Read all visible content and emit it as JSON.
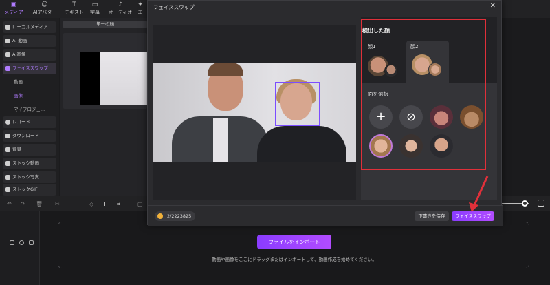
{
  "toolbar": {
    "items": [
      {
        "label": "メディア",
        "icon": "media-icon"
      },
      {
        "label": "AIアバター",
        "icon": "avatar-icon"
      },
      {
        "label": "テキスト",
        "icon": "text-icon"
      },
      {
        "label": "字幕",
        "icon": "subtitle-icon"
      },
      {
        "label": "オーディオ",
        "icon": "audio-icon"
      },
      {
        "label": "エ",
        "icon": "effects-icon"
      }
    ]
  },
  "sidebar": {
    "items": [
      {
        "label": "ローカルメディア"
      },
      {
        "label": "AI 動画"
      },
      {
        "label": "AI画像"
      },
      {
        "label": "フェイススワップ"
      },
      {
        "label": "レコード"
      },
      {
        "label": "ダウンロード"
      },
      {
        "label": "背景"
      },
      {
        "label": "ストック動画"
      },
      {
        "label": "ストック写真"
      },
      {
        "label": "ストックGIF"
      }
    ],
    "subitems": [
      {
        "label": "動画"
      },
      {
        "label": "画像"
      },
      {
        "label": "マイプロジェ..."
      }
    ]
  },
  "media_panel": {
    "tab_label": "単一の顔"
  },
  "dialog": {
    "title": "フェイススワップ",
    "detected_title": "検出した顔",
    "face_tabs": [
      {
        "label": "顔1"
      },
      {
        "label": "顔2"
      }
    ],
    "select_title": "面を選択",
    "credit": "2/2223825",
    "save_draft": "下書きを保存",
    "faceswap_button": "フェイススワップ"
  },
  "timeline": {
    "import_button": "ファイルをインポート",
    "hint": "動画や画像をここにドラッグまたはインポートして、動画作成を始めてください。"
  },
  "colors": {
    "accent": "#8a3cff",
    "accent_text": "#b07cff",
    "annotation": "#e0303a",
    "face_box": "#7b4dff"
  }
}
